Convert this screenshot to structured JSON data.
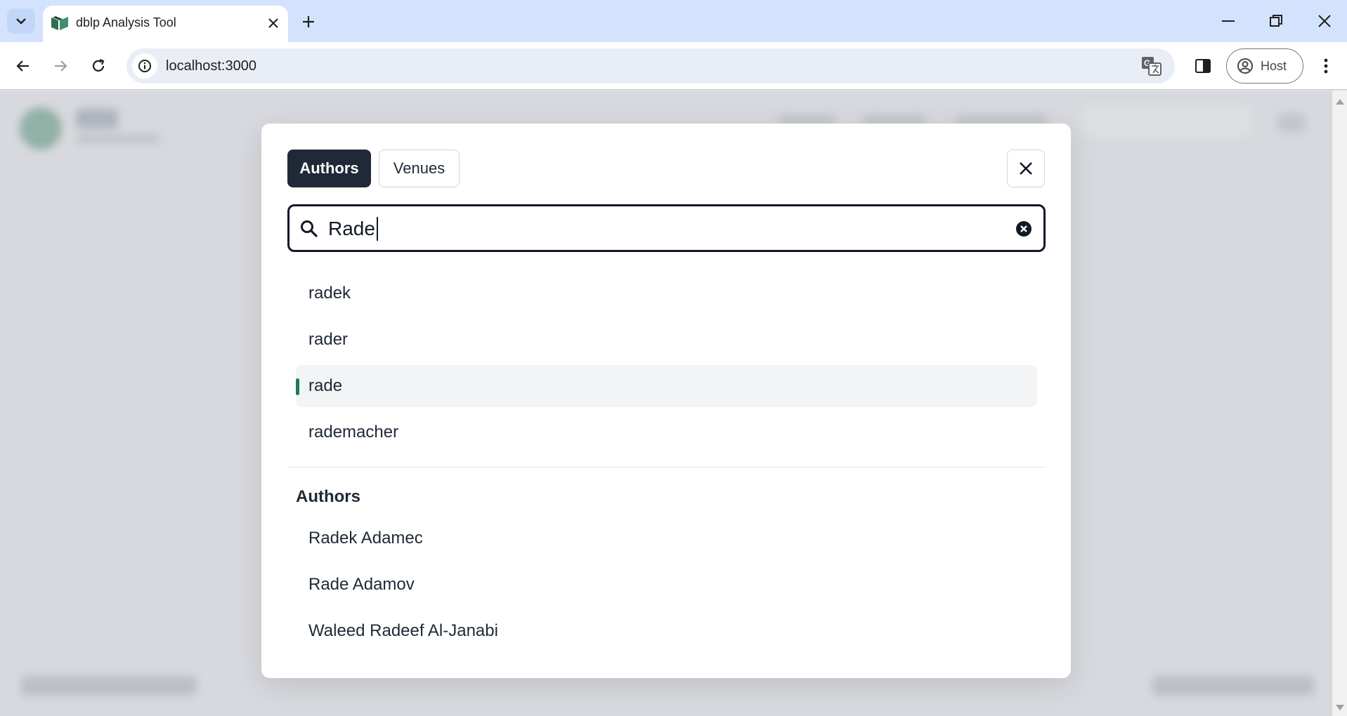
{
  "browser": {
    "tab_title": "dblp Analysis Tool",
    "url": "localhost:3000",
    "profile_label": "Host"
  },
  "modal": {
    "tabs": [
      {
        "label": "Authors",
        "active": true
      },
      {
        "label": "Venues",
        "active": false
      }
    ],
    "search": {
      "value": "Rade"
    },
    "suggestions": [
      {
        "label": "radek",
        "highlighted": false
      },
      {
        "label": "rader",
        "highlighted": false
      },
      {
        "label": "rade",
        "highlighted": true
      },
      {
        "label": "rademacher",
        "highlighted": false
      }
    ],
    "authors_heading": "Authors",
    "authors": [
      "Radek Adamec",
      "Rade Adamov",
      "Waleed Radeef Al-Janabi"
    ]
  },
  "colors": {
    "active_tab_bg": "#1f2937",
    "selection_accent": "#1f7a5c",
    "tabstrip_bg": "#d3e3fd"
  },
  "icons": [
    "tab-search-icon",
    "dblp-favicon-icon",
    "close-tab-icon",
    "new-tab-icon",
    "minimize-icon",
    "restore-icon",
    "close-window-icon",
    "back-icon",
    "forward-icon",
    "reload-icon",
    "site-info-icon",
    "translate-icon",
    "side-panel-icon",
    "profile-icon",
    "more-menu-icon",
    "close-icon",
    "search-icon",
    "clear-icon"
  ]
}
